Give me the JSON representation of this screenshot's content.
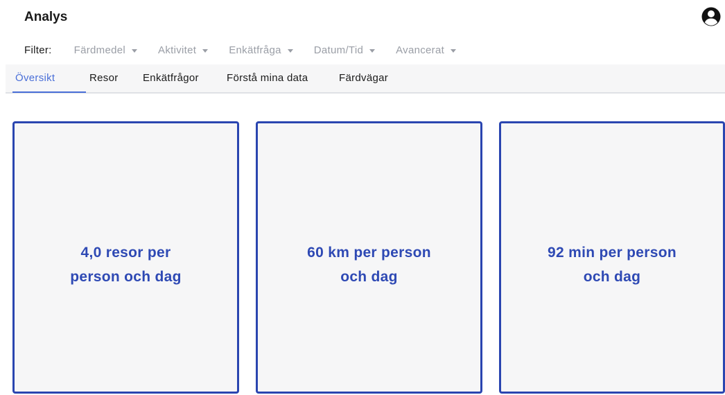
{
  "header": {
    "title": "Analys",
    "account_icon": "account-circle-icon"
  },
  "filters": {
    "label": "Filter:",
    "items": [
      {
        "label": "Färdmedel"
      },
      {
        "label": "Aktivitet"
      },
      {
        "label": "Enkätfråga"
      },
      {
        "label": "Datum/Tid"
      },
      {
        "label": "Avancerat"
      }
    ]
  },
  "tabs": [
    {
      "label": "Översikt",
      "active": true
    },
    {
      "label": "Resor"
    },
    {
      "label": "Enkätfrågor"
    },
    {
      "label": "Förstå mina data"
    },
    {
      "label": "Färdvägar"
    }
  ],
  "cards": [
    {
      "line1": "4,0 resor per",
      "line2": "person och dag"
    },
    {
      "line1": "60 km per person",
      "line2": "och dag"
    },
    {
      "line1": "92 min per person",
      "line2": "och dag"
    }
  ],
  "colors": {
    "accent": "#4a6fd8",
    "card_border": "#2a45b0",
    "card_text": "#2e49b4"
  }
}
